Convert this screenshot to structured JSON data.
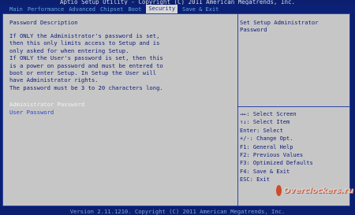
{
  "header": {
    "title": "Aptio Setup Utility - Copyright (C) 2011 American Megatrends, Inc.",
    "tabs": [
      {
        "label": "Main",
        "active": false
      },
      {
        "label": "Performance",
        "active": false
      },
      {
        "label": "Advanced",
        "active": false
      },
      {
        "label": "Chipset",
        "active": false
      },
      {
        "label": "Boot",
        "active": false
      },
      {
        "label": "Security",
        "active": true
      },
      {
        "label": "Save & Exit",
        "active": false
      }
    ]
  },
  "main": {
    "section_title": "Password Description",
    "description_lines": [
      "If ONLY the Administrator's password is set,",
      "then this only limits access to Setup and is",
      "only asked for when entering Setup.",
      "If ONLY the User's password is set, then this",
      "is a power on password and must be entered to",
      "boot or enter Setup. In Setup the User will",
      "have Administrator rights.",
      "The password must be 3 to 20 characters long."
    ],
    "items": {
      "administrator_password": "Administrator Password",
      "user_password": "User Password"
    }
  },
  "help_panel": {
    "text": "Set Setup Administrator Password",
    "key_help": [
      "→←: Select Screen",
      "↑↓: Select Item",
      "Enter: Select",
      "+/-: Change Opt.",
      "F1: General Help",
      "F2: Previous Values",
      "F3: Optimized Defaults",
      "F4: Save & Exit",
      "ESC: Exit"
    ]
  },
  "footer": {
    "text": "Version 2.11.1210. Copyright (C) 2011 American Megatrends, Inc."
  },
  "watermark": {
    "text": "Overclockers.ru"
  },
  "colors": {
    "background": "#0b1f6e",
    "panel": "#c6c6c6",
    "text": "#0d1d7a",
    "selected_item": "#f2f2f2",
    "active_tab_bg": "#d8d8d8"
  }
}
